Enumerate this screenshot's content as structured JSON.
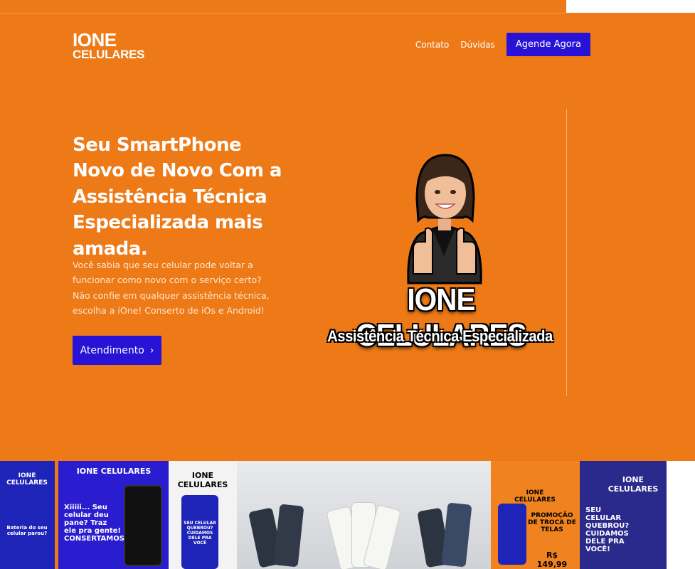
{
  "header": {
    "logo_line1": "IONE",
    "logo_line2": "CELULARES",
    "nav": [
      "Contato",
      "Dúvidas"
    ],
    "cta": "Agende Agora"
  },
  "hero": {
    "headline": "Seu SmartPhone Novo de Novo Com a Assistência Técnica Especializada mais amada.",
    "paragraph": "Você sabia que seu celular pode voltar a funcionar como novo com o serviço certo? Não confie em qualquer assistência técnica, escolha a iOne! Conserto de iOs e Android!",
    "button": "Atendimento",
    "button_icon": "chevron-right-icon",
    "brand_title": "IONE CELULARES",
    "brand_subtitle": "Assistência Técnica Especializada"
  },
  "gallery": {
    "tiles": [
      {
        "caption": "IONE CELULARES",
        "text": "Bateria do seu celular parou?"
      },
      {
        "caption": "IONE CELULARES",
        "text": "Xiiiii... Seu celular deu pane? Traz ele pra gente! CONSERTAMOS"
      },
      {
        "caption": "IONE CELULARES",
        "text": "SEU CELULAR QUEBROU? CUIDAMOS DELE PRA VOCÊ"
      },
      {
        "caption": "",
        "text": ""
      },
      {
        "caption": "",
        "text": ""
      },
      {
        "caption": "",
        "text": ""
      },
      {
        "caption": "IONE CELULARES",
        "text": "PROMOÇÃO DE TROCA DE TELAS",
        "price": "R$ 149,99"
      },
      {
        "caption": "IONE CELULARES",
        "text": "SEU CELULAR QUEBROU? CUIDAMOS DELE PRA VOCÊ!"
      }
    ]
  },
  "colors": {
    "primary_orange": "#EE7A17",
    "button_blue": "#2712D6"
  }
}
